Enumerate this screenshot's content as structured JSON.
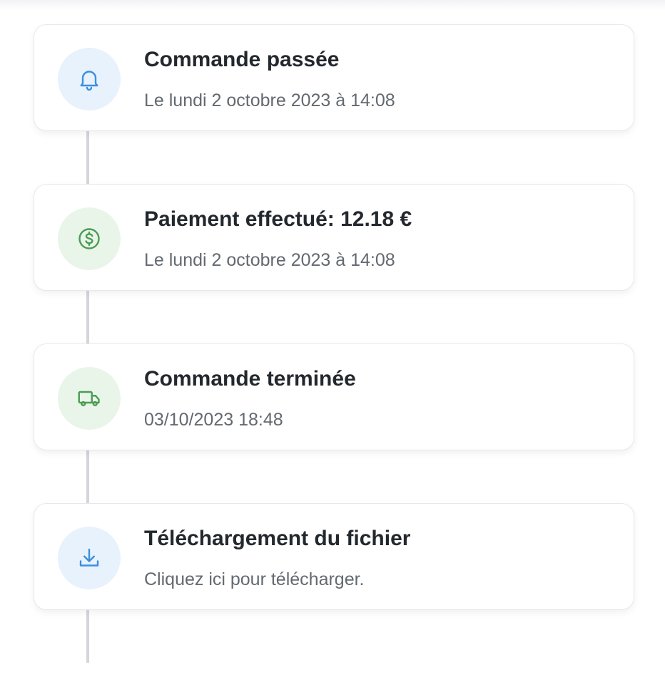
{
  "timeline": {
    "events": [
      {
        "title": "Commande passée",
        "subtitle": "Le lundi 2 octobre 2023 à 14:08",
        "icon": "bell-icon",
        "color": "#3c8fde"
      },
      {
        "title": "Paiement effectué: 12.18 €",
        "subtitle": "Le lundi 2 octobre 2023 à 14:08",
        "icon": "dollar-circle-icon",
        "color": "#4a9d52"
      },
      {
        "title": "Commande terminée",
        "subtitle": "03/10/2023 18:48",
        "icon": "truck-icon",
        "color": "#4a9d52"
      },
      {
        "title": "Téléchargement du fichier",
        "subtitle": "Cliquez ici pour télécharger.",
        "icon": "download-icon",
        "color": "#3c8fde"
      }
    ]
  }
}
